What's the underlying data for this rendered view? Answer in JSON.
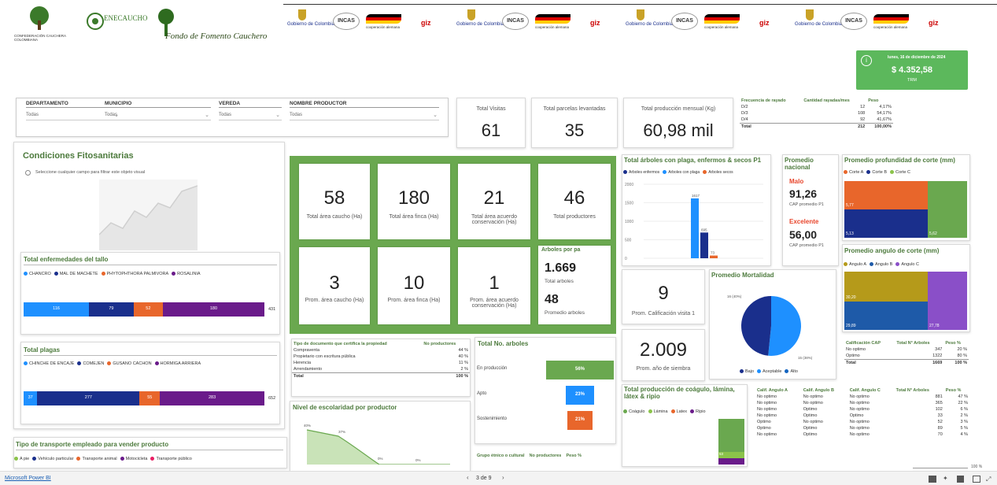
{
  "header": {
    "logo1_text": "CONFEDERACIÓN CAUCHERA COLOMBIANA",
    "logo2_name": "ENECAUCHO",
    "logo3_text": "Fondo de Fomento Cauchero",
    "partner_groups": [
      "Gobierno de Colombia",
      "INCAS",
      "cooperación alemana",
      "giz"
    ],
    "trm_date": "lunes, 16 de diciembre de 2024",
    "trm_value": "$ 4.352,58",
    "trm_label": "TRM"
  },
  "filters": [
    {
      "label": "DEPARTAMENTO",
      "value": "Todas"
    },
    {
      "label": "MUNICIPIO",
      "value": "Todas"
    },
    {
      "label": "VEREDA",
      "value": "Todas"
    },
    {
      "label": "NOMBRE PRODUCTOR",
      "value": "Todas"
    }
  ],
  "kpis_top": {
    "visitas_label": "Total Visitas",
    "visitas_value": "61",
    "parcelas_label": "Total parcelas levantadas",
    "parcelas_value": "35",
    "produccion_label": "Total producción mensual (Kg)",
    "produccion_value": "60,98 mil"
  },
  "frecuencia": {
    "headers": [
      "Frecuencia de rayado",
      "Cantidad rayadas/mes",
      "Peso"
    ],
    "rows": [
      [
        "D/2",
        "12",
        "4,17%"
      ],
      [
        "D/3",
        "108",
        "54,17%"
      ],
      [
        "D/4",
        "92",
        "41,67%"
      ]
    ],
    "total": [
      "Total",
      "212",
      "100,00%"
    ]
  },
  "fitosanitarias": {
    "title": "Condiciones Fitosanitarias",
    "hint": "Seleccione cualquier campo para filtrar este objeto visual"
  },
  "enfermedades": {
    "title": "Total enfermedades del tallo",
    "legend": [
      {
        "name": "CHANCRO",
        "color": "#1e90ff"
      },
      {
        "name": "MAL DE MACHETE",
        "color": "#1a2f8c"
      },
      {
        "name": "PHYTOPHTHORA PALMIVORA",
        "color": "#e8662b"
      },
      {
        "name": "ROSALINIA",
        "color": "#6a1b8a"
      }
    ],
    "values": [
      "116",
      "79",
      "52",
      "180"
    ],
    "total": "431"
  },
  "plagas": {
    "title": "Total plagas",
    "legend": [
      {
        "name": "CHINCHE DE ENCAJE",
        "color": "#1e90ff"
      },
      {
        "name": "COMEJEN",
        "color": "#1a2f8c"
      },
      {
        "name": "GUSANO CACHON",
        "color": "#e8662b"
      },
      {
        "name": "HORMIGA ARRIERA",
        "color": "#6a1b8a"
      }
    ],
    "values": [
      "37",
      "277",
      "55",
      "283"
    ],
    "total": "652"
  },
  "transporte": {
    "title": "Tipo de transporte empleado para vender producto",
    "legend": [
      {
        "name": "A pie",
        "color": "#8bc34a"
      },
      {
        "name": "Vehículo particular",
        "color": "#1a2f8c"
      },
      {
        "name": "Transporte animal",
        "color": "#e8662b"
      },
      {
        "name": "Motocicleta",
        "color": "#6a1b8a"
      },
      {
        "name": "Transporte público",
        "color": "#e91e63"
      }
    ]
  },
  "center_kpis": [
    {
      "value": "58",
      "label": "Total área caucho (Ha)"
    },
    {
      "value": "180",
      "label": "Total área finca (Ha)"
    },
    {
      "value": "21",
      "label": "Total área acuerdo conservación (Ha)"
    },
    {
      "value": "46",
      "label": "Total productores"
    },
    {
      "value": "3",
      "label": "Prom. área caucho (Ha)"
    },
    {
      "value": "10",
      "label": "Prom. área finca (Ha)"
    },
    {
      "value": "1",
      "label": "Prom. área acuerdo conservación (Ha)"
    }
  ],
  "arboles_pa": {
    "title": "Arboles por pa",
    "total_value": "1.669",
    "total_label": "Total arboles",
    "prom_value": "48",
    "prom_label": "Promedio arboles"
  },
  "arboles_plaga": {
    "title": "Total árboles con plaga, enfermos & secos P1",
    "legend": [
      {
        "name": "Arboles enfermos",
        "color": "#1a2f8c"
      },
      {
        "name": "Arboles con plaga",
        "color": "#1e90ff"
      },
      {
        "name": "Arboles secos",
        "color": "#e8662b"
      }
    ],
    "yticks": [
      "2000",
      "1500",
      "1000",
      "500",
      "0"
    ],
    "labels": [
      "1617",
      "695",
      "73"
    ]
  },
  "promedio_nacional": {
    "title": "Promedio nacional",
    "malo_label": "Malo",
    "malo_value": "91,26",
    "malo_sub": "CAP promedio P1",
    "exc_label": "Excelente",
    "exc_value": "56,00",
    "exc_sub": "CAP promedio P1"
  },
  "prof_corte": {
    "title": "Promedio profundidad de corte (mm)",
    "legend": [
      {
        "name": "Corte A",
        "color": "#e8662b"
      },
      {
        "name": "Corte B",
        "color": "#1a2f8c"
      },
      {
        "name": "Corte C",
        "color": "#8bc34a"
      }
    ],
    "labels": [
      "5,77",
      "5,13",
      "5,62"
    ]
  },
  "angulo_corte": {
    "title": "Promedio angulo de corte (mm)",
    "legend": [
      {
        "name": "Angulo A",
        "color": "#b59a1a"
      },
      {
        "name": "Angulo B",
        "color": "#1e5aa8"
      },
      {
        "name": "Angulo C",
        "color": "#8a4fc8"
      }
    ],
    "labels": [
      "30,20",
      "29,89",
      "27,78"
    ]
  },
  "calificacion": {
    "value": "9",
    "label": "Prom. Calificación visita 1"
  },
  "mortalidad": {
    "title": "Promedio Mortalidad",
    "label_a": "16 (40%)",
    "label_b": "15 (38%)",
    "legend": [
      {
        "name": "Bajo",
        "color": "#1a2f8c"
      },
      {
        "name": "Aceptable",
        "color": "#1e90ff"
      },
      {
        "name": "Alto",
        "color": "#1565c0"
      }
    ]
  },
  "siembra": {
    "value": "2.009",
    "label": "Prom. año de siembra"
  },
  "cap_table": {
    "headers": [
      "Calificación CAP",
      "Total N° Arboles",
      "Peso %"
    ],
    "rows": [
      [
        "No optimo",
        "347",
        "20 %"
      ],
      [
        "Optimo",
        "1322",
        "80 %"
      ]
    ],
    "total": [
      "Total",
      "1669",
      "100 %"
    ]
  },
  "documento": {
    "headers": [
      "Tipo de documento que certifica la propiedad",
      "No productores"
    ],
    "rows": [
      [
        "Compraventa",
        "44 %"
      ],
      [
        "Propietario con escritura pública",
        "40 %"
      ],
      [
        "Herencia",
        "11 %"
      ],
      [
        "Arrendamiento",
        "2 %"
      ]
    ],
    "total": [
      "Total",
      "100 %"
    ]
  },
  "no_arboles": {
    "title": "Total No. arboles",
    "rows": [
      {
        "label": "En producción",
        "value": "56%",
        "pct": 56,
        "color": "#6aa84f"
      },
      {
        "label": "Apto",
        "value": "23%",
        "pct": 23,
        "color": "#1e90ff"
      },
      {
        "label": "Sostenimiento",
        "value": "21%",
        "pct": 21,
        "color": "#e8662b"
      }
    ]
  },
  "escolaridad": {
    "title": "Nivel de escolaridad por productor",
    "labels": [
      "40%",
      "37%",
      "0%",
      "0%"
    ]
  },
  "grupo": {
    "headers": [
      "Grupo étnico o cultural",
      "No productores",
      "Peso %"
    ]
  },
  "produccion_coagulo": {
    "title": "Total producción de coágulo, lámina, látex & ripio",
    "legend": [
      {
        "name": "Coágulo",
        "color": "#6aa84f"
      },
      {
        "name": "Lámina",
        "color": "#8bc34a"
      },
      {
        "name": "Latex",
        "color": "#e8662b"
      },
      {
        "name": "Ripio",
        "color": "#6a1b8a"
      }
    ],
    "label": "53"
  },
  "angulos_table": {
    "headers": [
      "Calif. Angulo A",
      "Calif. Angulo B",
      "Calif. Angulo C",
      "Total N° Arboles",
      "Peso %"
    ],
    "rows": [
      [
        "No optimo",
        "No optimo",
        "No optimo",
        "881",
        "47 %"
      ],
      [
        "No optimo",
        "No optimo",
        "No optimo",
        "365",
        "22 %"
      ],
      [
        "No optimo",
        "Optimo",
        "No optimo",
        "102",
        "6 %"
      ],
      [
        "No optimo",
        "Optimo",
        "Optimo",
        "33",
        "2 %"
      ],
      [
        "Optimo",
        "No optimo",
        "No optimo",
        "52",
        "3 %"
      ],
      [
        "Optimo",
        "Optimo",
        "No optimo",
        "89",
        "5 %"
      ],
      [
        "No optimo",
        "Optimo",
        "No optimo",
        "70",
        "4 %"
      ]
    ]
  },
  "footer": {
    "app": "Microsoft Power BI",
    "page": "3 de 9",
    "zoom": "100 %"
  },
  "chart_data": [
    {
      "type": "bar",
      "title": "Total enfermedades del tallo",
      "categories": [
        "CHANCRO",
        "MAL DE MACHETE",
        "PHYTOPHTHORA PALMIVORA",
        "ROSALINIA"
      ],
      "values": [
        116,
        79,
        52,
        180
      ]
    },
    {
      "type": "bar",
      "title": "Total plagas",
      "categories": [
        "CHINCHE DE ENCAJE",
        "COMEJEN",
        "GUSANO CACHON",
        "HORMIGA ARRIERA"
      ],
      "values": [
        37,
        277,
        55,
        283
      ]
    },
    {
      "type": "bar",
      "title": "Total árboles con plaga, enfermos & secos P1",
      "categories": [
        "Arboles enfermos",
        "Arboles con plaga",
        "Arboles secos"
      ],
      "values": [
        1617,
        695,
        73
      ],
      "ylim": [
        0,
        2000
      ]
    },
    {
      "type": "pie",
      "title": "Promedio Mortalidad",
      "categories": [
        "Bajo",
        "Aceptable"
      ],
      "values": [
        16,
        15
      ]
    },
    {
      "type": "bar",
      "title": "Total No. arboles",
      "categories": [
        "En producción",
        "Apto",
        "Sostenimiento"
      ],
      "values": [
        56,
        23,
        21
      ]
    }
  ]
}
